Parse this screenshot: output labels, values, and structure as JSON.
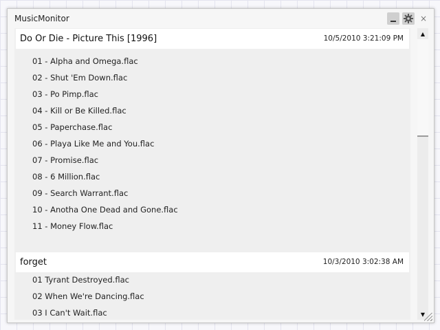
{
  "window": {
    "title": "MusicMonitor",
    "minimize_icon": "minimize-icon",
    "settings_icon": "gear-icon",
    "close_label": "×"
  },
  "albums": [
    {
      "title": "Do Or Die - Picture This [1996]",
      "date": "10/5/2010 3:21:09 PM",
      "tracks": [
        "01 - Alpha and Omega.flac",
        "02 - Shut 'Em Down.flac",
        "03 - Po Pimp.flac",
        "04 - Kill or Be Killed.flac",
        "05 - Paperchase.flac",
        "06 - Playa Like Me and You.flac",
        "07 - Promise.flac",
        "08 - 6 Million.flac",
        "09 - Search Warrant.flac",
        "10 - Anotha One Dead and Gone.flac",
        "11 - Money Flow.flac"
      ]
    },
    {
      "title": "forget",
      "date": "10/3/2010 3:02:38 AM",
      "tracks": [
        "01 Tyrant Destroyed.flac",
        "02 When We're Dancing.flac",
        "03 I Can't Wait.flac"
      ]
    }
  ],
  "scrollbar": {
    "up_arrow": "▲",
    "down_arrow": "▼"
  },
  "colors": {
    "content_bg": "#efefef",
    "header_bg": "#ffffff",
    "window_bg": "#f6f6f6"
  }
}
